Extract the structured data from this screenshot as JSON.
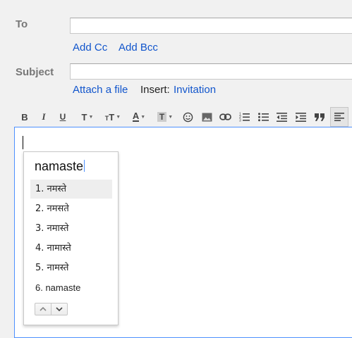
{
  "to_label": "To",
  "to_value": "",
  "add_cc": "Add Cc",
  "add_bcc": "Add Bcc",
  "subject_label": "Subject",
  "subject_value": "",
  "attach_file": "Attach a file",
  "insert_label": "Insert:",
  "invitation": "Invitation",
  "toolbar": {
    "bold": "B",
    "italic": "I",
    "underline": "U",
    "font": "T",
    "size": "T",
    "color": "A",
    "highlight": "T",
    "icons": [
      "bold-icon",
      "italic-icon",
      "underline-icon",
      "font-icon",
      "font-size-icon",
      "text-color-icon",
      "highlight-icon",
      "emoji-icon",
      "image-icon",
      "link-icon",
      "numbered-list-icon",
      "bulleted-list-icon",
      "indent-less-icon",
      "indent-more-icon",
      "quote-icon",
      "align-icon"
    ]
  },
  "ime": {
    "input": "namaste",
    "candidates": [
      "1. नमस्ते",
      "2. नमसते",
      "3. नमास्ते",
      "4. नामास्ते",
      "5. नामस्ते",
      "6. namaste"
    ],
    "selected_index": 0
  },
  "colors": {
    "link": "#1155cc",
    "focus_border": "#4d90fe"
  }
}
